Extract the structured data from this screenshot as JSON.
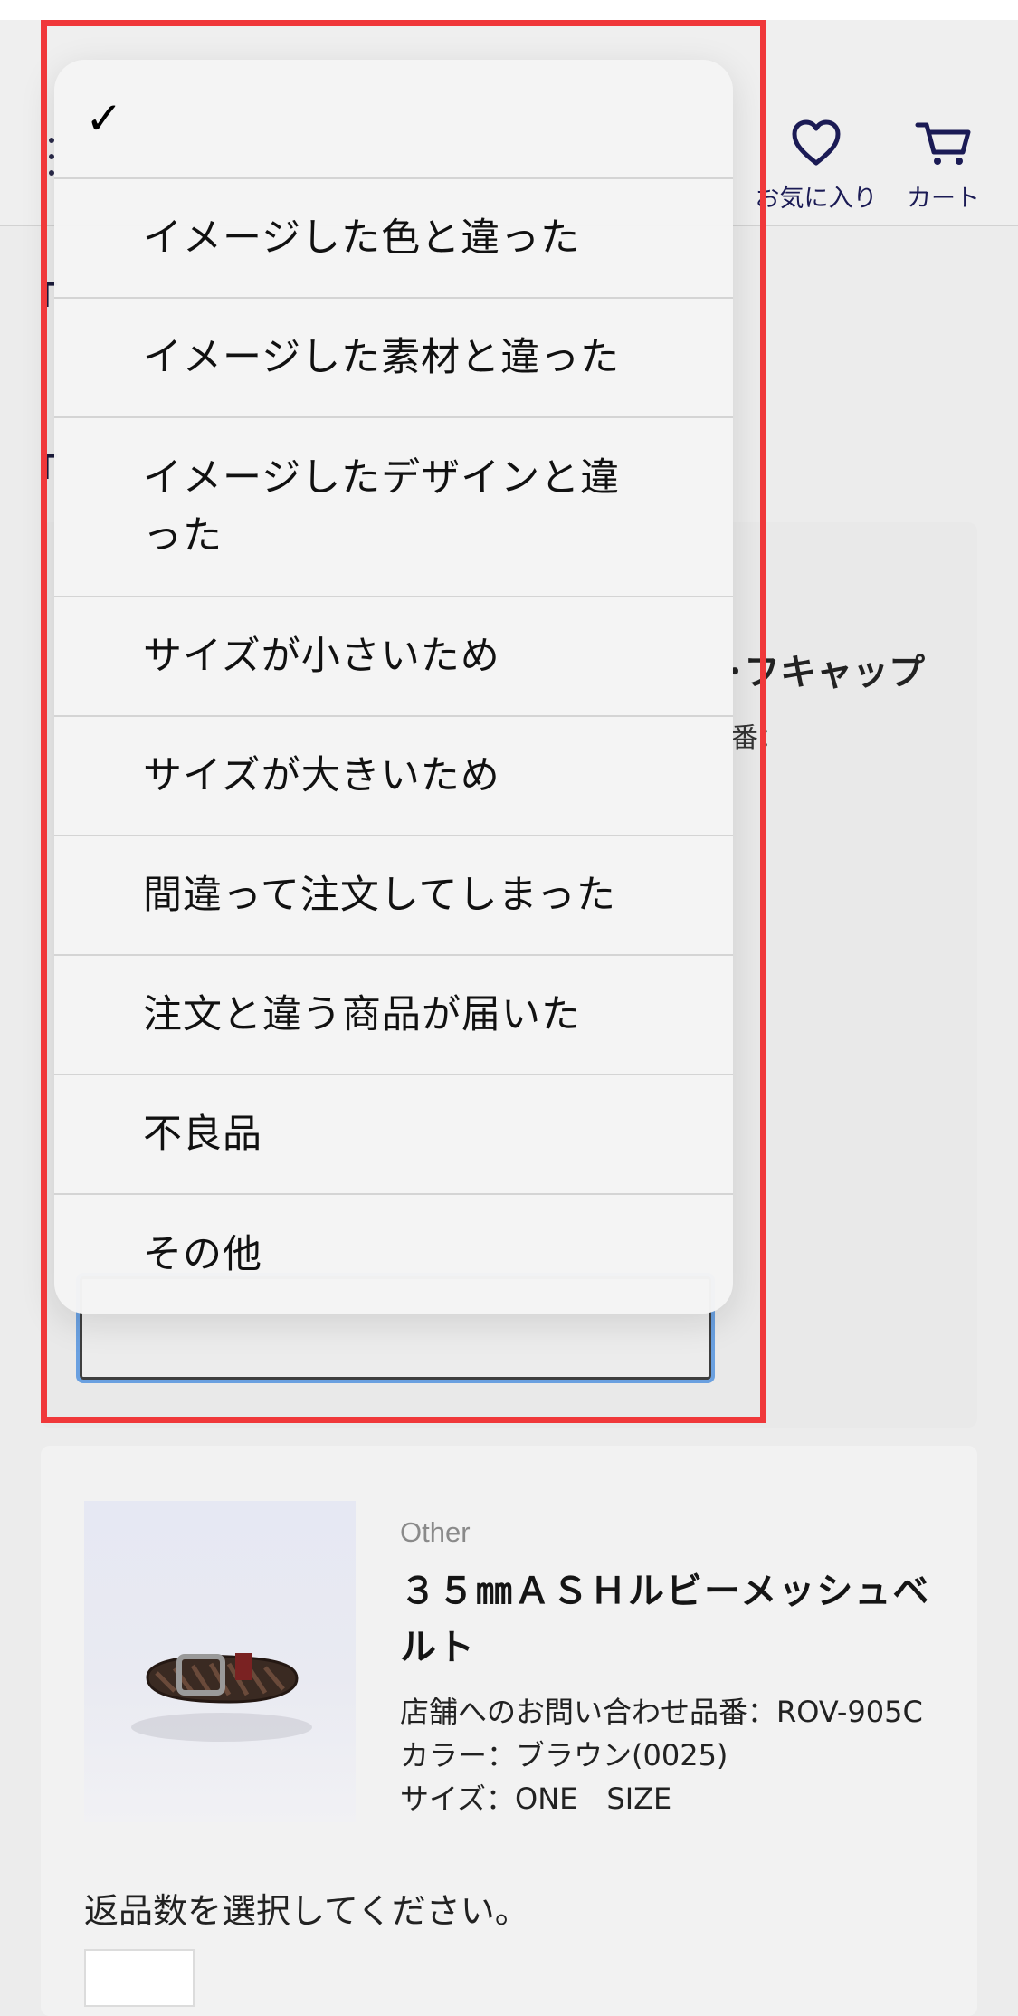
{
  "header": {
    "favorites_label": "お気に入り",
    "cart_label": "カート",
    "favorites_icon": "heart-icon",
    "cart_icon": "cart-icon"
  },
  "background": {
    "partial_title": "･フキャップ",
    "partial_code": "番："
  },
  "dropdown": {
    "selected_index": 0,
    "options": [
      "",
      "イメージした色と違った",
      "イメージした素材と違った",
      "イメージしたデザインと違った",
      "サイズが小さいため",
      "サイズが大きいため",
      "間違って注文してしまった",
      "注文と違う商品が届いた",
      "不良品",
      "その他"
    ]
  },
  "product": {
    "brand": "Other",
    "name": "３５㎜ＡＳＨルビーメッシュベルト",
    "code": "店舗へのお問い合わせ品番：ROV-905C",
    "color": "カラー：ブラウン(0025)",
    "size": "サイズ：ONE　SIZE",
    "qty_prompt": "返品数を選択してください。"
  },
  "colors": {
    "highlight": "#f0383a",
    "focus_ring": "#6aa0e0",
    "header_icon": "#1b1b55"
  }
}
